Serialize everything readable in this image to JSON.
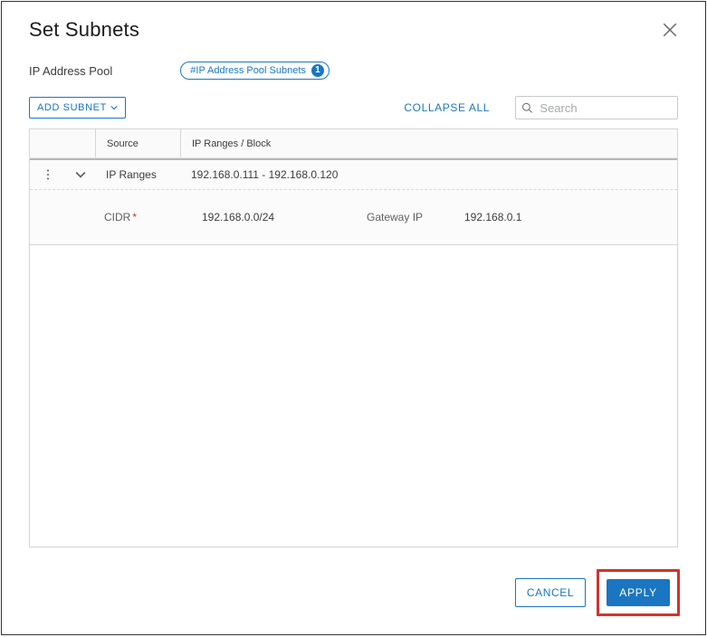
{
  "dialog": {
    "title": "Set Subnets"
  },
  "pool": {
    "label": "IP Address Pool",
    "chip_text": "#IP Address Pool Subnets",
    "chip_count": "1"
  },
  "toolbar": {
    "add_subnet_label": "ADD SUBNET",
    "collapse_label": "COLLAPSE ALL",
    "search_placeholder": "Search"
  },
  "grid": {
    "headers": {
      "source": "Source",
      "ranges": "IP Ranges / Block"
    },
    "rows": [
      {
        "source": "IP Ranges",
        "ranges": "192.168.0.111 - 192.168.0.120",
        "detail": {
          "cidr_label": "CIDR",
          "cidr_value": "192.168.0.0/24",
          "gateway_label": "Gateway IP",
          "gateway_value": "192.168.0.1"
        }
      }
    ]
  },
  "footer": {
    "cancel_label": "CANCEL",
    "apply_label": "APPLY"
  }
}
